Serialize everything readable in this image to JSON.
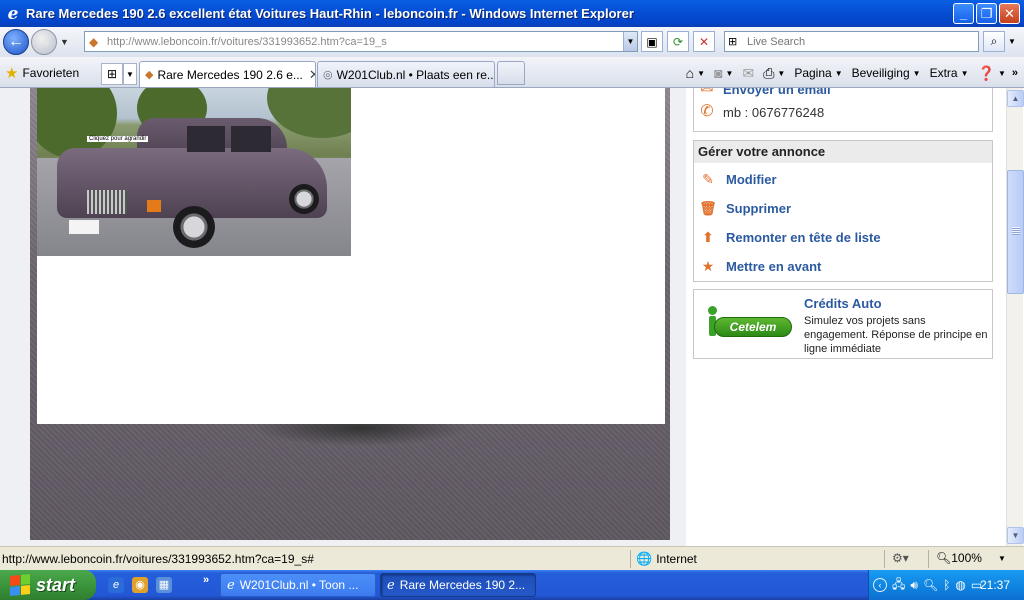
{
  "window": {
    "title": "Rare Mercedes 190 2.6 excellent état Voitures Haut-Rhin - leboncoin.fr - Windows Internet Explorer"
  },
  "address": {
    "url": "http://www.leboncoin.fr/voitures/331993652.htm?ca=19_s",
    "search_placeholder": "Live Search"
  },
  "tabs": {
    "favorites_label": "Favorieten",
    "items": [
      {
        "label": "Rare Mercedes 190 2.6 e...",
        "active": true
      },
      {
        "label": "W201Club.nl • Plaats een re...",
        "active": false
      }
    ]
  },
  "commandbar": {
    "page_label": "Pagina",
    "security_label": "Beveiliging",
    "extra_label": "Extra",
    "more_label": "»"
  },
  "photo": {
    "tag_text": "Cliquez pour agrandir"
  },
  "sidebar": {
    "contact": {
      "email_label": "Envoyer un email",
      "phone_label": "mb : 0676776248"
    },
    "manage": {
      "title": "Gérer votre annonce",
      "items": [
        {
          "label": "Modifier",
          "icon": "pencil-icon"
        },
        {
          "label": "Supprimer",
          "icon": "trash-icon"
        },
        {
          "label": "Remonter en tête de liste",
          "icon": "arrow-up-icon"
        },
        {
          "label": "Mettre en avant",
          "icon": "star-icon"
        }
      ]
    },
    "credit": {
      "logo_text": "Cetelem",
      "title": "Crédits Auto",
      "description": "Simulez vos projets sans engagement. Réponse de principe en ligne immédiate"
    }
  },
  "statusbar": {
    "text": "http://www.leboncoin.fr/voitures/331993652.htm?ca=19_s#",
    "zone": "Internet",
    "zoom": "100%"
  },
  "taskbar": {
    "start_label": "start",
    "items": [
      {
        "label": "W201Club.nl • Toon ...",
        "active": false
      },
      {
        "label": "Rare Mercedes 190 2...",
        "active": true
      }
    ],
    "clock": "21:37"
  },
  "colors": {
    "link_blue": "#2c5aa0",
    "accent_orange": "#e2712d",
    "cetelem_green": "#3aa12a"
  }
}
